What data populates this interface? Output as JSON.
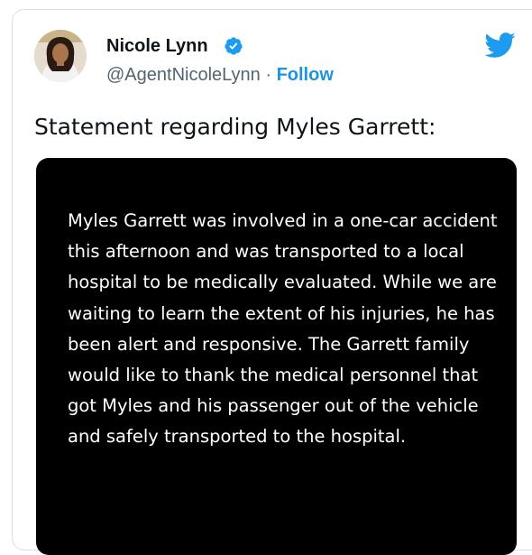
{
  "tweet": {
    "author": {
      "display_name": "Nicole Lynn",
      "handle": "@AgentNicoleLynn",
      "separator": " · ",
      "follow_label": "Follow",
      "verified": true
    },
    "brand": {
      "logo_icon": "twitter-bird-icon",
      "accent_color": "#1d9bf0"
    },
    "text": "Statement regarding Myles Garrett:",
    "media": {
      "statement_text": "Myles Garrett was involved in a one-car accident this afternoon and was transported to a local hospital to be medically evaluated. While we are waiting to learn the extent of his injuries, he has been alert and responsive. The Garrett family would like to thank the medical personnel that got Myles and his passenger out of the vehicle and safely transported to the hospital."
    }
  }
}
